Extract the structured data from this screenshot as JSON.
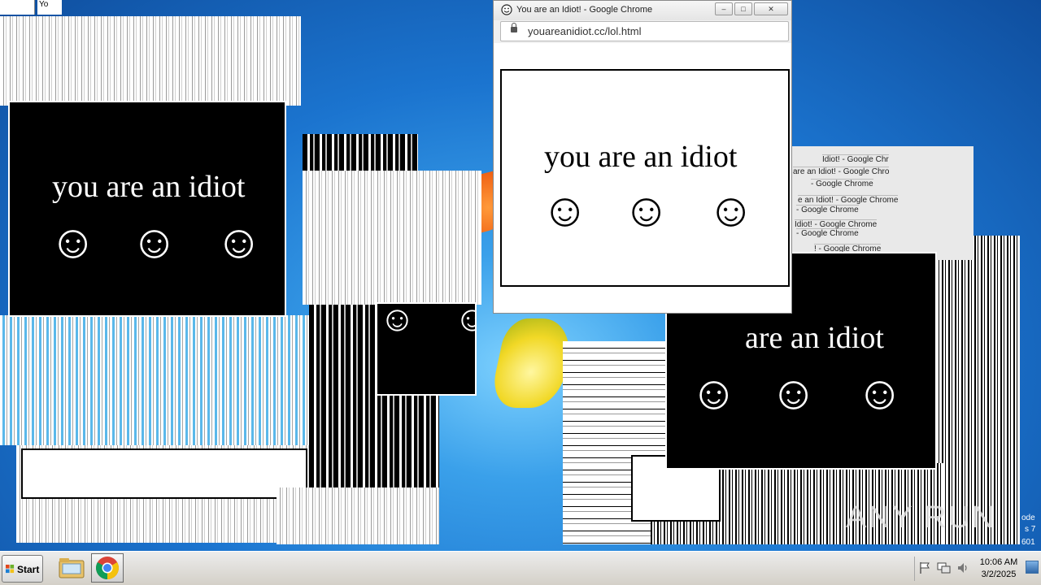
{
  "desktop": {
    "idiot_text": "you are an idiot",
    "idiot_text_partial": "are an idiot",
    "smiley_glyph": "☺",
    "colors": {
      "desktop_blue": "#1b74cf",
      "panel_dark": "#000000",
      "panel_light": "#ffffff"
    }
  },
  "chrome_window": {
    "title": "You are an Idiot! - Google Chrome",
    "url": "youareanidiot.cc/lol.html",
    "minimize_label": "–",
    "maximize_label": "□",
    "close_label": "✕"
  },
  "ghost_titles": [
    "Idiot! - Google Chr",
    "are an Idiot! - Google Chro",
    "- Google Chrome",
    "e an Idiot! - Google Chrome",
    "- Google Chrome",
    "Idiot! - Google Chrome",
    "- Google Chrome",
    "! - Google Chrome"
  ],
  "corner_glitch_title": "Yo",
  "watermark": "ANY RUN",
  "right_edge_text": {
    "line1": "ode",
    "line2": "s 7",
    "line3": "601"
  },
  "taskbar": {
    "start_label": "Start",
    "apps": [
      {
        "name": "File Explorer",
        "icon": "folder-icon"
      },
      {
        "name": "Google Chrome",
        "icon": "chrome-icon"
      }
    ],
    "tray_icons": [
      "flag-icon",
      "network-icon",
      "volume-icon"
    ],
    "clock_time": "10:06 AM",
    "clock_date": "3/2/2025"
  }
}
